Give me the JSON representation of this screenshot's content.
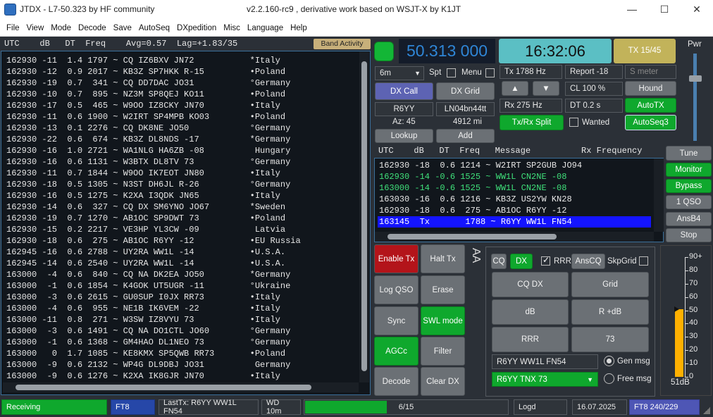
{
  "window": {
    "title": "JTDX - L7-50.323  by HF community",
    "subtitle": "v2.2.160-rc9 , derivative work based on WSJT-X by K1JT",
    "min": "—",
    "max": "☐",
    "close": "✕"
  },
  "menu": [
    "File",
    "View",
    "Mode",
    "Decode",
    "Save",
    "AutoSeq",
    "DXpedition",
    "Misc",
    "Language",
    "Help"
  ],
  "band": {
    "header": "UTC    dB   DT  Freq    Avg=0.57  Lag=+1.83/35",
    "activity_label": "Band Activity"
  },
  "band_rows": [
    "162930 -11  1.4 1797 ~ CQ IZ6BXV JN72           *Italy",
    "162930 -12  0.9 2017 ~ KB3Z SP7HKK R-15         •Poland",
    "162930 -19  0.7  341 ~ CQ DD7DAC JO31           °Germany",
    "162930 -10  0.7  895 ~ NZ3M SP8QEJ KO11         •Poland",
    "162930 -17  0.5  465 ~ W9OO IZ8CKY JN70         •Italy",
    "162930 -11  0.6 1900 ~ W2IRT SP4MPB KO03        •Poland",
    "162930 -13  0.1 2276 ~ CQ DK8NE JO50            °Germany",
    "162930 -22  0.6  674 ~ KB3Z DL8NDS -17          *Germany",
    "162930 -16  1.0 2721 ~ WA1NLG HA6ZB -08          Hungary",
    "162930 -16  0.6 1131 ~ W3BTX DL8TV 73           °Germany",
    "162930 -11  0.7 1844 ~ W9OO IK7EOT JN80         •Italy",
    "162930 -18  0.5 1305 ~ N3ST DH6JL R-26          °Germany",
    "162930 -16  0.5 1275 ~ K2XA I3QDK JN65          •Italy",
    "162930 -14  0.6  327 ~ CQ DX SM6YNO JO67        *Sweden",
    "162930 -19  0.7 1270 ~ AB1OC SP9DWT 73          •Poland",
    "162930 -15  0.2 2217 ~ VE3HP YL3CW -09           Latvia",
    "162930 -18  0.6  275 ~ AB1OC R6YY -12           •EU Russia",
    "162945 -16  0.6 2788 ~ UY2RA WW1L -14           •U.S.A.",
    "162945 -14  0.6 2540 ~ UY2RA WW1L -14           •U.S.A.",
    "163000  -4  0.6  840 ~ CQ NA DK2EA JO50         *Germany",
    "163000  -1  0.6 1854 ~ K4GOK UT5UGR -11         °Ukraine",
    "163000  -3  0.6 2615 ~ GU0SUP I0JX RR73         •Italy",
    "163000  -4  0.6  955 ~ NE1B IK6VEM -22          •Italy",
    "163000 -11  0.8  271 ~ W3SW IZ8VYU 73           •Italy",
    "163000  -3  0.6 1491 ~ CQ NA DO1CTL JO60        °Germany",
    "163000  -1  0.6 1368 ~ GM4HAO DL1NEO 73         °Germany",
    "163000   0  1.7 1085 ~ KE8KMX SP5QWB RR73       •Poland",
    "163000  -9  0.6 2132 ~ WP4G DL9DBJ JO31          Germany",
    "163000  -9  0.6 1276 ~ K2XA IK8GJR JN70         •Italy"
  ],
  "control": {
    "frequency": "50.313 000",
    "clock": "16:32:06",
    "tx_period": "TX 15/45",
    "pwr_label": "Pwr",
    "band_select": "6m",
    "spt": "Spt",
    "menu_label": "Menu",
    "dx_call_btn": "DX Call",
    "dx_grid_btn": "DX Grid",
    "dx_call": "R6YY",
    "dx_grid": "LN04bn44tt",
    "az": "Az: 45",
    "dist": "4912 mi",
    "lookup": "Lookup",
    "add": "Add",
    "tx_freq": "Tx  1788  Hz",
    "rx_freq": "Rx  275  Hz",
    "up": "▲",
    "down": "▼",
    "report": "Report -18",
    "s_meter": "S meter",
    "cl": "CL  100  %",
    "hound": "Hound",
    "dt": "DT 0.2 s",
    "autotx": "AutoTX",
    "txrx_split": "Tx/Rx Split",
    "wanted": "Wanted",
    "autoseq": "AutoSeq3"
  },
  "rx": {
    "header": "UTC    dB   DT  Freq   Message          Rx Frequency",
    "rows": [
      {
        "text": "162930 -18  0.6 1214 ~ W2IRT SP2GUB JO94",
        "color": "#e6e6e6",
        "bg": ""
      },
      {
        "text": "162930 -14 -0.6 1525 ~ WW1L CN2NE -08",
        "color": "#3fe07a",
        "bg": ""
      },
      {
        "text": "163000 -14 -0.6 1525 ~ WW1L CN2NE -08",
        "color": "#3fe07a",
        "bg": ""
      },
      {
        "text": "163030 -16  0.6 1216 ~ KB3Z US2YW KN28",
        "color": "#e6e6e6",
        "bg": ""
      },
      {
        "text": "162930 -18  0.6  275 ~ AB1OC R6YY -12",
        "color": "#e6e6e6",
        "bg": ""
      },
      {
        "text": "163145  Tx       1788 ~ R6YY WW1L FN54",
        "color": "#ffffff",
        "bg": "#1414ff"
      }
    ]
  },
  "side": {
    "tune": "Tune",
    "monitor": "Monitor",
    "bypass": "Bypass",
    "qso": "1 QSO",
    "ansb4": "AnsB4",
    "stop": "Stop"
  },
  "lower": {
    "enable_tx": "Enable Tx",
    "halt_tx": "Halt Tx",
    "log_qso": "Log QSO",
    "erase": "Erase",
    "sync": "Sync",
    "swl": "SWL mode",
    "agcc": "AGCc",
    "filter": "Filter",
    "decode": "Decode",
    "clear_dx": "Clear DX",
    "arrows": "AA"
  },
  "msg": {
    "cq": "CQ",
    "dx": "DX",
    "rrr": "RRR",
    "anscq": "AnsCQ",
    "skpgrid": "SkpGrid",
    "cq_dx": "CQ DX",
    "grid": "Grid",
    "db": "dB",
    "r_db": "R +dB",
    "rrr_btn": "RRR",
    "b73": "73",
    "gen_text": "R6YY WW1L FN54",
    "gen_label": "Gen msg",
    "free_text": "R6YY TNX 73",
    "free_label": "Free msg"
  },
  "meter": {
    "ticks": [
      "90+",
      "80",
      "70",
      "60",
      "50",
      "40",
      "30",
      "20",
      "10",
      "0"
    ],
    "level_db": 51,
    "reading": "51dB"
  },
  "status": {
    "receiving": "Receiving",
    "mode": "FT8",
    "lasttx": "LastTx: R6YY WW1L FN54",
    "wd": "WD 10m",
    "progress_text": "6/15",
    "progress_fraction": 0.4,
    "logd": "Logd",
    "date": "16.07.2025",
    "counts": "FT8  240/229"
  }
}
